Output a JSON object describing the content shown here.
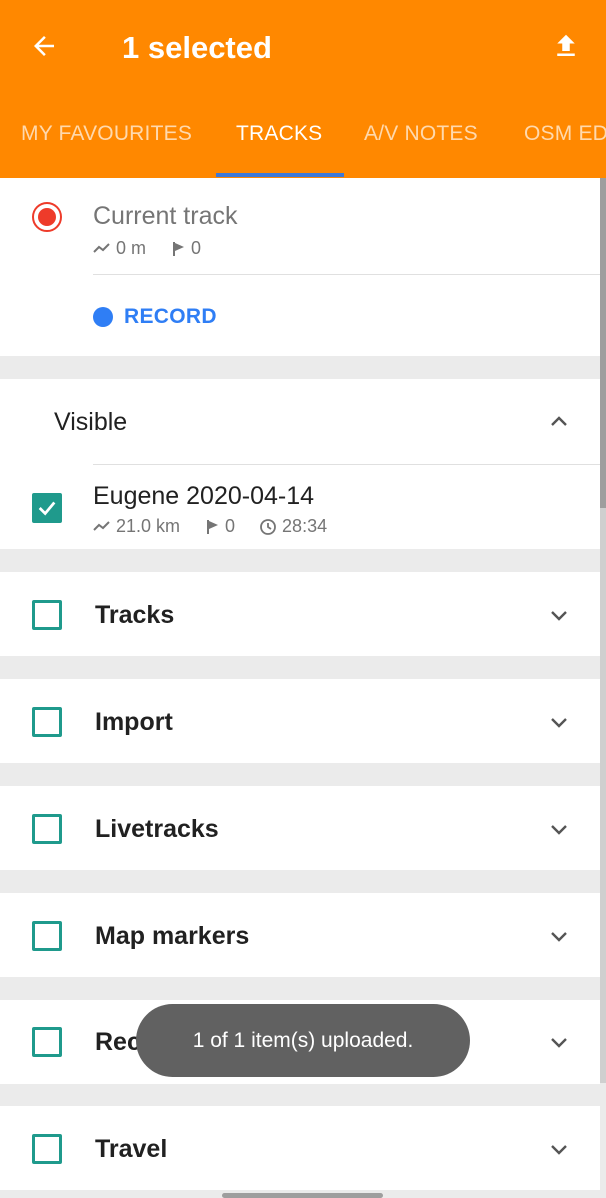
{
  "appbar": {
    "title": "1 selected",
    "back_icon": "arrow-back-icon",
    "upload_icon": "upload-icon",
    "color": "#ff8800"
  },
  "tabs": [
    {
      "label": "MY FAVOURITES",
      "active": false
    },
    {
      "label": "TRACKS",
      "active": true
    },
    {
      "label": "A/V NOTES",
      "active": false
    },
    {
      "label": "OSM ED",
      "active": false
    }
  ],
  "current_track": {
    "title": "Current track",
    "distance": "0 m",
    "waypoints": "0",
    "record_label": "RECORD"
  },
  "visible_section": {
    "title": "Visible",
    "expanded": true,
    "tracks": [
      {
        "name": "Eugene 2020-04-14",
        "distance": "21.0 km",
        "waypoints": "0",
        "duration": "28:34",
        "checked": true
      }
    ]
  },
  "groups": [
    {
      "label": "Tracks",
      "checked": false
    },
    {
      "label": "Import",
      "checked": false
    },
    {
      "label": "Livetracks",
      "checked": false
    },
    {
      "label": "Map markers",
      "checked": false
    },
    {
      "label": "Rec",
      "checked": false
    },
    {
      "label": "Travel",
      "checked": false
    }
  ],
  "toast": {
    "message": "1 of 1 item(s) uploaded."
  },
  "colors": {
    "accent_orange": "#ff8800",
    "checkbox_teal": "#1f9a8c",
    "record_blue": "#2f7ef5",
    "record_red": "#ee3b2a"
  }
}
